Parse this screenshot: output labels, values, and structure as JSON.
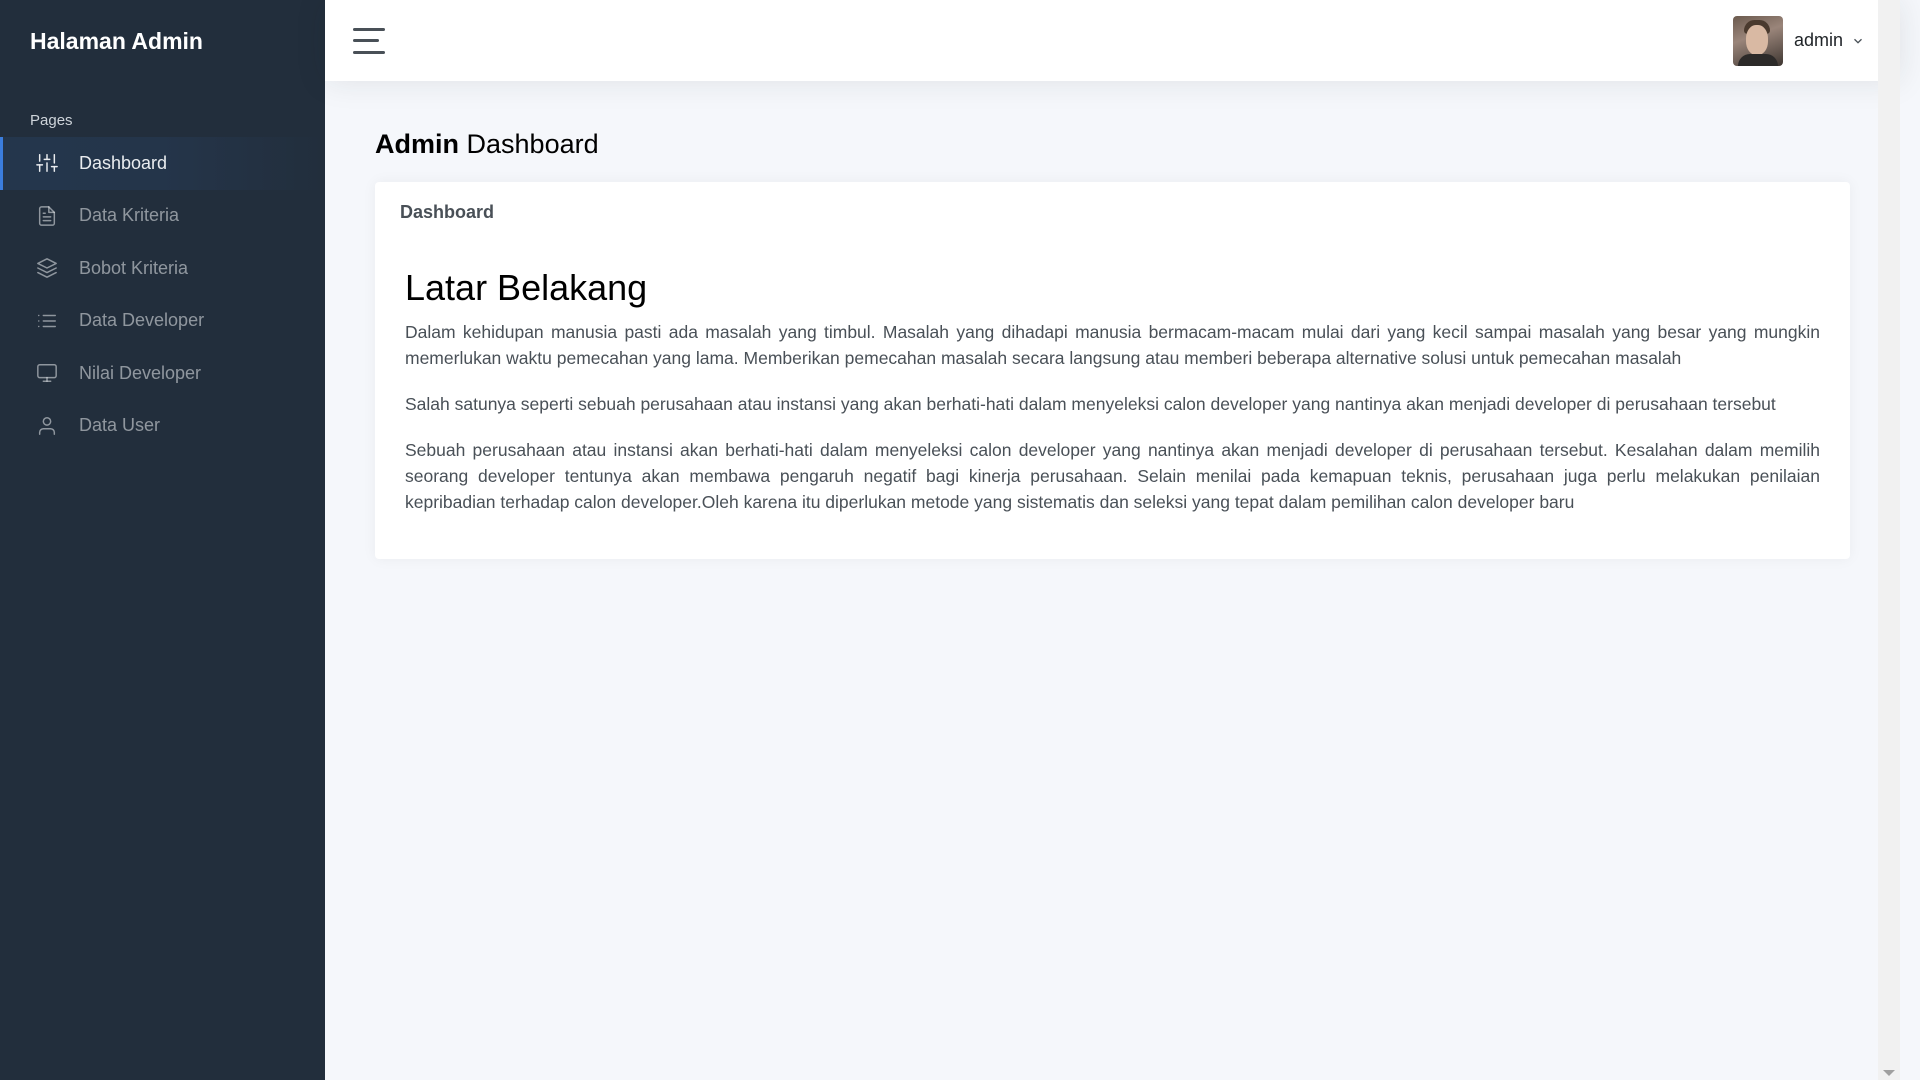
{
  "sidebar": {
    "brand": "Halaman Admin",
    "header": "Pages",
    "items": [
      {
        "label": "Dashboard",
        "icon": "sliders-icon",
        "active": true
      },
      {
        "label": "Data Kriteria",
        "icon": "file-text-icon",
        "active": false
      },
      {
        "label": "Bobot Kriteria",
        "icon": "layers-icon",
        "active": false
      },
      {
        "label": "Data Developer",
        "icon": "list-icon",
        "active": false
      },
      {
        "label": "Nilai Developer",
        "icon": "monitor-icon",
        "active": false
      },
      {
        "label": "Data User",
        "icon": "user-icon",
        "active": false
      }
    ]
  },
  "topbar": {
    "user_name": "admin"
  },
  "page": {
    "title_strong": "Admin",
    "title_rest": "Dashboard"
  },
  "card": {
    "header": "Dashboard",
    "section_title": "Latar Belakang",
    "paragraphs": [
      "Dalam kehidupan manusia pasti ada masalah yang timbul. Masalah yang dihadapi manusia bermacam-macam mulai dari yang kecil sampai masalah yang besar yang mungkin memerlukan waktu pemecahan yang lama. Memberikan pemecahan masalah secara langsung atau memberi beberapa alternative solusi untuk pemecahan masalah",
      "Salah satunya seperti sebuah perusahaan atau instansi yang akan berhati-hati dalam menyeleksi calon developer yang nantinya akan menjadi developer di perusahaan tersebut",
      "Sebuah perusahaan atau instansi akan berhati-hati dalam menyeleksi calon developer yang nantinya akan menjadi developer di perusahaan tersebut. Kesalahan dalam memilih seorang developer tentunya akan membawa pengaruh negatif bagi kinerja perusahaan. Selain menilai pada kemapuan teknis, perusahaan juga perlu melakukan penilaian kepribadian terhadap calon developer.Oleh karena itu diperlukan metode yang sistematis dan seleksi yang tepat dalam pemilihan calon developer baru"
    ]
  },
  "colors": {
    "sidebar_bg": "#222e3c",
    "accent": "#3b7ddd",
    "content_bg": "#f5f7fb"
  }
}
